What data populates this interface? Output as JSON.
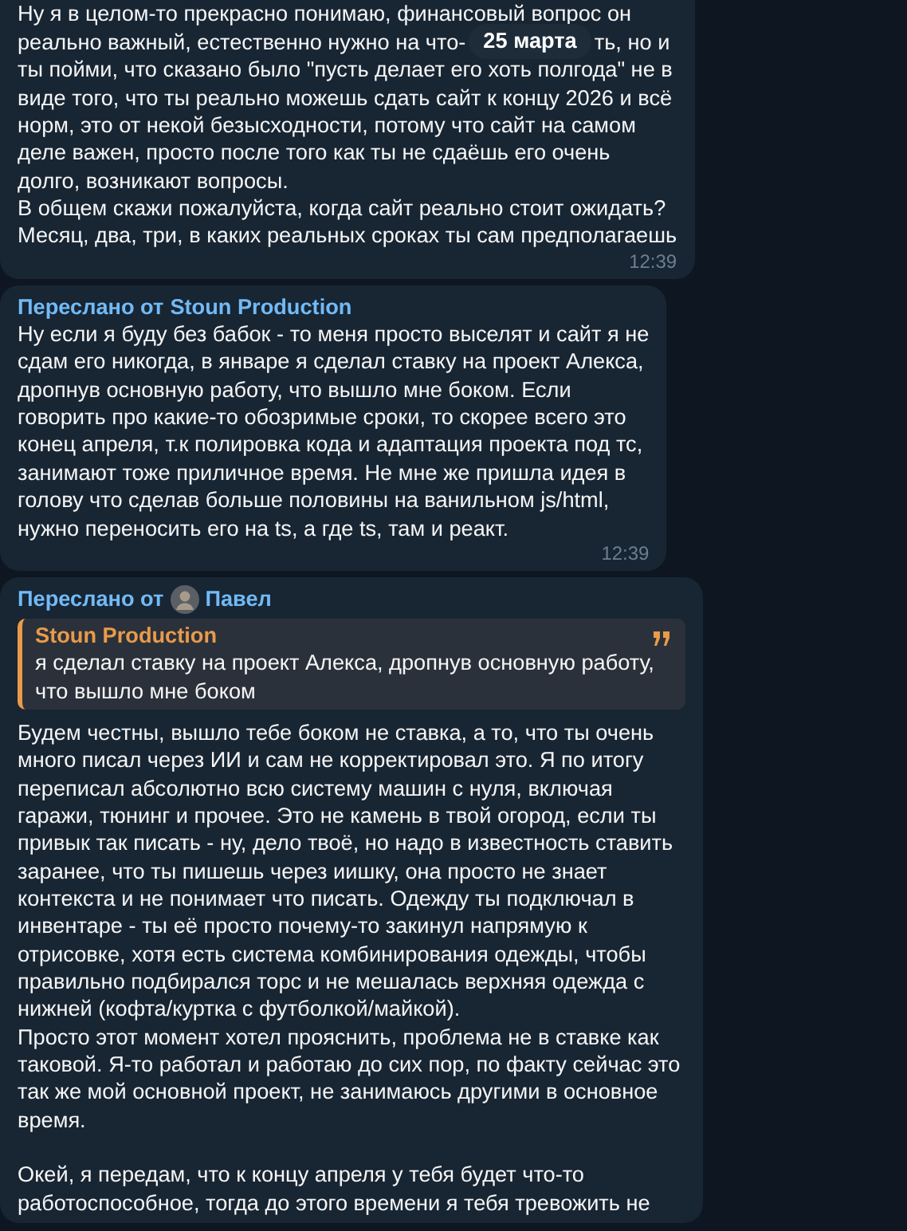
{
  "date_pill": "25 марта",
  "messages": [
    {
      "kind": "plain",
      "top_line": "Ну я в целом-то прекрасно понимаю, финансовый вопрос он",
      "split_line": {
        "left": "реально важный, естественно нужно на что-",
        "right": "ть, но и"
      },
      "paragraphs": [
        {
          "lines": [
            "ты пойми, что сказано было \"пусть делает его хоть полгода\" не в",
            "виде того, что ты реально можешь сдать сайт к концу 2026 и всё",
            "норм, это от некой безысходности, потому что сайт на самом",
            "деле важен, просто после того как ты не сдаёшь его очень",
            "долго, возникают вопросы."
          ]
        },
        {
          "lines": [
            "В общем скажи пожалуйста, когда сайт реально стоит ожидать?",
            "Месяц, два, три, в каких реальных сроках ты сам предполагаешь"
          ]
        }
      ],
      "time": "12:39"
    },
    {
      "kind": "forwarded",
      "forwarded_from": {
        "prefix": "Переслано от",
        "name": "Stoun Production"
      },
      "paragraphs": [
        {
          "lines": [
            "Ну если я буду без бабок - то меня просто выселят и сайт я не",
            "сдам его никогда, в январе я сделал ставку на проект Алекса,",
            "дропнув основную работу, что вышло мне боком. Если",
            "говорить про какие-то обозримые сроки, то скорее всего это",
            "конец апреля, т.к полировка кода и адаптация проекта под тс,",
            "занимают тоже приличное время. Не мне же пришла идея в",
            "голову что сделав больше половины на ванильном js/html,",
            "нужно переносить его на ts, а где ts, там и реакт."
          ]
        }
      ],
      "time": "12:39"
    },
    {
      "kind": "forwarded",
      "forwarded_from": {
        "prefix": "Переслано от",
        "name": "Павел",
        "has_avatar": true
      },
      "quote": {
        "title": "Stoun Production",
        "lines": [
          "я сделал ставку на проект Алекса, дропнув основную работу,",
          "что вышло мне боком"
        ]
      },
      "paragraphs": [
        {
          "lines": [
            "Будем честны, вышло тебе боком не ставка, а то, что ты очень",
            "много писал через ИИ и сам не корректировал это. Я по итогу",
            "переписал абсолютно всю систему машин с нуля, включая",
            "гаражи, тюнинг и прочее. Это не камень в твой огород, если ты",
            "привык так писать - ну, дело твоё, но надо в известность ставить",
            "заранее, что ты пишешь через иишку, она просто не знает",
            "контекста и не понимает что писать. Одежду ты подключал в",
            "инвентаре - ты её просто почему-то закинул напрямую к",
            "отрисовке, хотя есть система комбинирования одежды, чтобы",
            "правильно подбирался торс и не мешалась верхняя одежда с",
            "нижней (кофта/куртка с футболкой/майкой)."
          ]
        },
        {
          "lines": [
            "Просто этот момент хотел прояснить, проблема не в ставке как",
            "таковой. Я-то работал и работаю до сих пор, по факту сейчас это",
            "так же мой основной проект, не занимаюсь другими в основное",
            "время."
          ]
        },
        {
          "gap_before": true,
          "lines": [
            "Окей, я передам, что к концу апреля у тебя будет что-то",
            "работоспособное, тогда до этого времени я тебя тревожить не"
          ]
        }
      ]
    }
  ]
}
